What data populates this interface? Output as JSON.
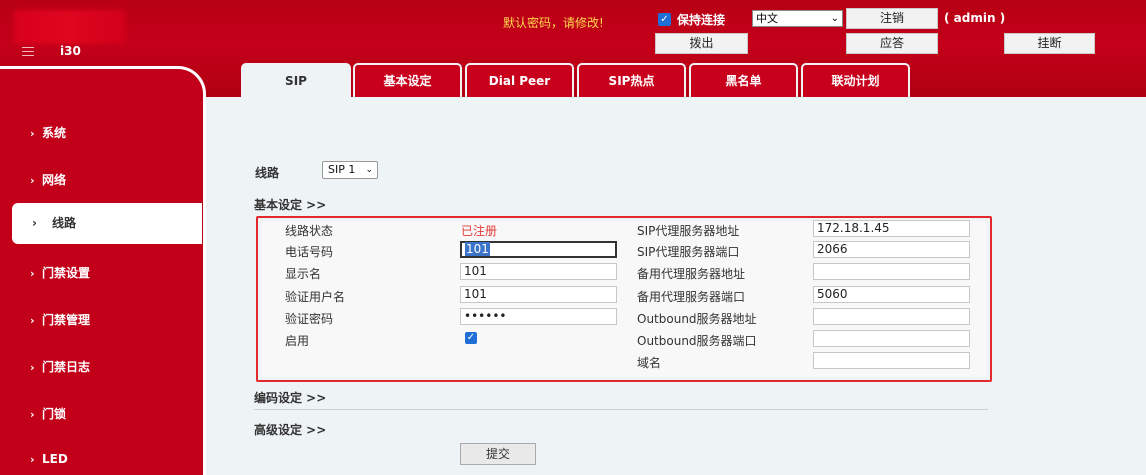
{
  "header": {
    "model": "i30",
    "warning": "默认密码，请修改!",
    "keep_connected": "保持连接",
    "language": "中文",
    "logout": "注销",
    "user": "( admin )",
    "dial_out": "拨出",
    "answer": "应答",
    "hangup": "挂断"
  },
  "tabs": [
    "SIP",
    "基本设定",
    "Dial Peer",
    "SIP热点",
    "黑名单",
    "联动计划"
  ],
  "sidebar": {
    "items": [
      "系统",
      "网络",
      "线路",
      "门禁设置",
      "门禁管理",
      "门禁日志",
      "门锁",
      "LED"
    ]
  },
  "main": {
    "line_label": "线路",
    "line_value": "SIP 1",
    "basic_title": "基本设定 >>",
    "left": {
      "status_label": "线路状态",
      "status_value": "已注册",
      "phone_label": "电话号码",
      "phone_value": "101",
      "display_label": "显示名",
      "display_value": "101",
      "auth_user_label": "验证用户名",
      "auth_user_value": "101",
      "auth_pwd_label": "验证密码",
      "auth_pwd_value": "••••••",
      "enable_label": "启用"
    },
    "right": {
      "proxy_addr_label": "SIP代理服务器地址",
      "proxy_addr_value": "172.18.1.45",
      "proxy_port_label": "SIP代理服务器端口",
      "proxy_port_value": "2066",
      "backup_addr_label": "备用代理服务器地址",
      "backup_addr_value": "",
      "backup_port_label": "备用代理服务器端口",
      "backup_port_value": "5060",
      "outbound_addr_label": "Outbound服务器地址",
      "outbound_addr_value": "",
      "outbound_port_label": "Outbound服务器端口",
      "outbound_port_value": "",
      "domain_label": "域名",
      "domain_value": ""
    },
    "codec_title": "编码设定 >>",
    "advanced_title": "高级设定 >>",
    "submit": "提交"
  },
  "colors": {
    "brand": "#c20019",
    "accent_border": "#e3282d",
    "warning": "#ffd84d"
  }
}
